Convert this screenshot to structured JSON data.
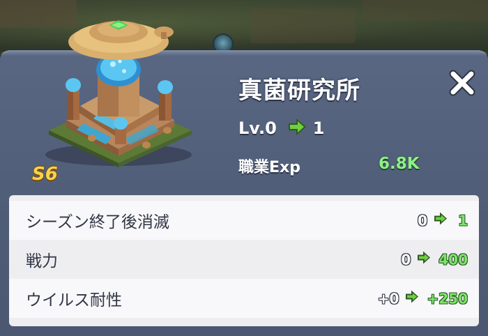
{
  "building": {
    "name": "真菌研究所",
    "season_badge": "S6",
    "level_from": "Lv.0",
    "level_to": "1",
    "exp_label": "職業Exp",
    "exp_value": "6.8K"
  },
  "stats": [
    {
      "label": "シーズン終了後消滅",
      "from": "0",
      "to": "1"
    },
    {
      "label": "戦力",
      "from": "0",
      "to": "400"
    },
    {
      "label": "ウイルス耐性",
      "from": "+0",
      "to": "+250"
    }
  ],
  "colors": {
    "panel": "#55627d",
    "exp_value": "#8ef08a",
    "increase_value": "#7de36a",
    "arrow_green": "#6fd13f",
    "badge_gold": "#f6d34a"
  },
  "icons": {
    "close": "close-icon",
    "level_arrow": "arrow-right-icon",
    "stat_arrow": "arrow-right-icon"
  }
}
